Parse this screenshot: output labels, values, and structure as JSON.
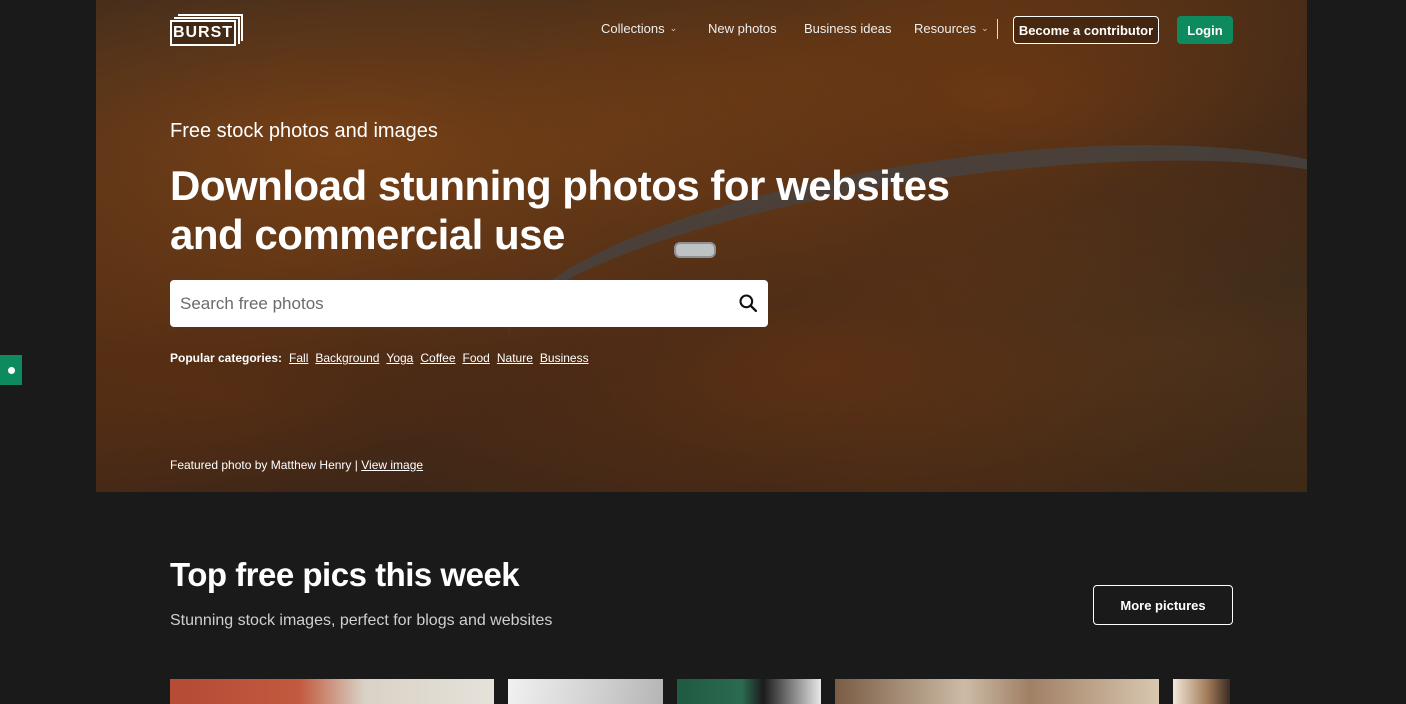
{
  "brand": {
    "logo_text": "BURST"
  },
  "nav": {
    "items": [
      {
        "label": "Collections",
        "has_dropdown": true
      },
      {
        "label": "New photos",
        "has_dropdown": false
      },
      {
        "label": "Business ideas",
        "has_dropdown": false
      },
      {
        "label": "Resources",
        "has_dropdown": true
      }
    ],
    "contributor_label": "Become a contributor",
    "login_label": "Login"
  },
  "hero": {
    "eyebrow": "Free stock photos and images",
    "headline": "Download stunning photos for websites and commercial use",
    "search_placeholder": "Search free photos",
    "categories_label": "Popular categories:",
    "categories": [
      "Fall",
      "Background",
      "Yoga",
      "Coffee",
      "Food",
      "Nature",
      "Business"
    ],
    "featured_text": "Featured photo by Matthew Henry |",
    "featured_link": "View image"
  },
  "section": {
    "title": "Top free pics this week",
    "subtitle": "Stunning stock images, perfect for blogs and websites",
    "more_label": "More pictures"
  },
  "colors": {
    "accent": "#0e8a5f",
    "background": "#1a1a1a"
  }
}
